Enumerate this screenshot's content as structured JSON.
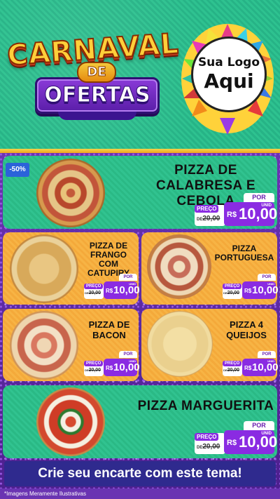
{
  "header": {
    "title_line1": "CARNAVAL",
    "title_de": "DE",
    "title_line2": "OFERTAS",
    "logo_line1": "Sua Logo",
    "logo_line2": "Aqui"
  },
  "badge": "-50%",
  "price_common": {
    "preco_label": "PREÇO",
    "old_prefix": "DE",
    "old_value": "20,00",
    "por_label": "POR",
    "currency": "R$",
    "new_value": "10,00",
    "unit": "UNID"
  },
  "products": [
    {
      "name": "PIZZA DE CALABRESA E CEBOLA"
    },
    {
      "name": "PIZZA DE FRANGO COM CATUPIRY"
    },
    {
      "name": "PIZZA PORTUGUESA"
    },
    {
      "name": "PIZZA DE BACON"
    },
    {
      "name": "PIZZA 4 QUEIJOS"
    },
    {
      "name": "PIZZA MARGUERITA"
    }
  ],
  "cta": "Crie seu encarte com este tema!",
  "disclaimer": "*Imagens Meramente Ilustrativas",
  "colors": {
    "header_green": "#2ec290",
    "card_green": "#31c390",
    "card_orange": "#f7b445",
    "glitter_purple": "#6a34b2",
    "price_purple": "#8a2be2",
    "cta_navy": "#2f2a8e"
  }
}
